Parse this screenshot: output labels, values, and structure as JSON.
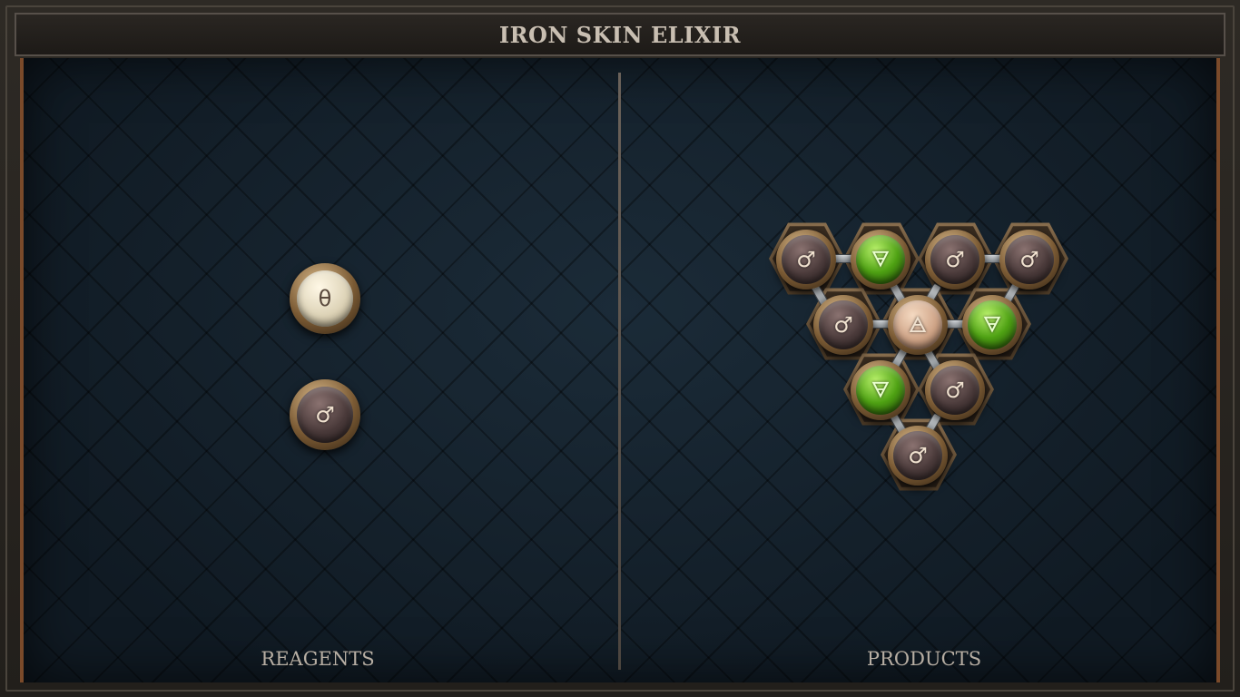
{
  "title": "IRON SKIN ELIXIR",
  "reagents": {
    "label": "REAGENTS",
    "items": [
      {
        "element": "salt",
        "glyph": "θ"
      },
      {
        "element": "iron",
        "glyph": "♂"
      }
    ]
  },
  "products": {
    "label": "PRODUCTS",
    "molecule": [
      {
        "element": "iron",
        "glyph": "♂"
      },
      {
        "element": "earth",
        "glyph": "🜃"
      },
      {
        "element": "iron",
        "glyph": "♂"
      },
      {
        "element": "iron",
        "glyph": "♂"
      },
      {
        "element": "iron",
        "glyph": "♂"
      },
      {
        "element": "quintessence",
        "glyph": "🜁"
      },
      {
        "element": "earth",
        "glyph": "🜃"
      },
      {
        "element": "earth",
        "glyph": "🜃"
      },
      {
        "element": "iron",
        "glyph": "♂"
      },
      {
        "element": "iron",
        "glyph": "♂"
      }
    ]
  },
  "colors": {
    "board": "#13202b",
    "frame": "#2e2a25",
    "iron": "#4a3a3a",
    "earth": "#4fa214",
    "salt": "#ddd3b7",
    "accent_edge": "#7a4a2a"
  }
}
